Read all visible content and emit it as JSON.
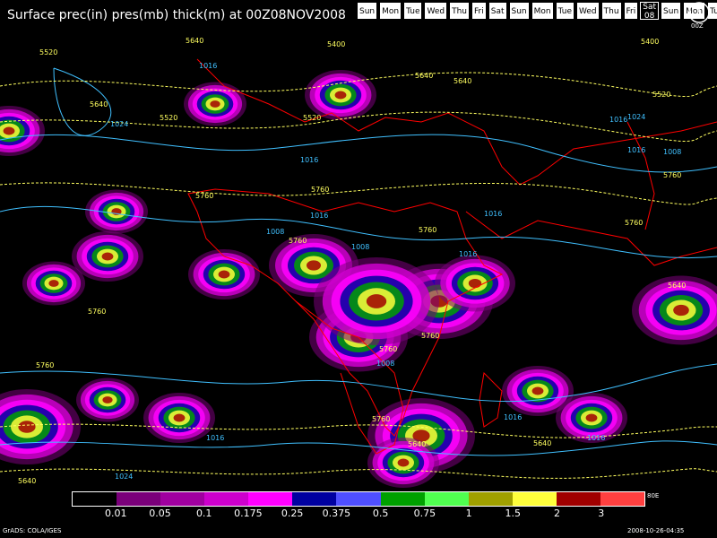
{
  "title": "Surface prec(in) pres(mb) thick(m) at 00Z08NOV2008",
  "days": [
    "Sun",
    "Mon",
    "Tue",
    "Wed",
    "Thu",
    "Fri",
    "Sat",
    "Sun",
    "Mon",
    "Tue",
    "Wed",
    "Thu",
    "Fri",
    "Sat",
    "Sun",
    "Mon",
    "Tue"
  ],
  "active_day": {
    "name": "Sat",
    "date": "08"
  },
  "clock_label": "00Z",
  "legend": {
    "colors": [
      "#000000",
      "#7a007a",
      "#a000a0",
      "#cc00cc",
      "#ff00ff",
      "#0000a0",
      "#4f4fff",
      "#00a000",
      "#50ff50",
      "#a0a000",
      "#ffff3c",
      "#a00000",
      "#ff4040"
    ],
    "ticks": [
      "0.01",
      "0.05",
      "0.1",
      "0.175",
      "0.25",
      "0.375",
      "0.5",
      "0.75",
      "1",
      "1.5",
      "2",
      "3"
    ]
  },
  "lon_label": "80E",
  "credit": "GrADS: COLA/IGES",
  "timestamp": "2008-10-26-04:35",
  "isobar_labels": [
    "1024",
    "1016",
    "1016",
    "1024",
    "1016",
    "1008",
    "1008",
    "1016",
    "1008",
    "1016",
    "1016",
    "1016",
    "1024",
    "1016",
    "1016",
    "1008",
    "1016"
  ],
  "thickness_labels": [
    "5520",
    "5640",
    "5520",
    "5640",
    "5400",
    "5520",
    "5640",
    "5760",
    "5760",
    "5760",
    "5760",
    "5760",
    "5760",
    "5760",
    "5760",
    "5760",
    "5640",
    "5640",
    "5640",
    "5400",
    "5520",
    "5640",
    "5760",
    "5760",
    "5520",
    "5640"
  ],
  "colors": {
    "isobar": "#40c0ff",
    "thickness": "#ffff60",
    "coast": "#ff0000"
  }
}
